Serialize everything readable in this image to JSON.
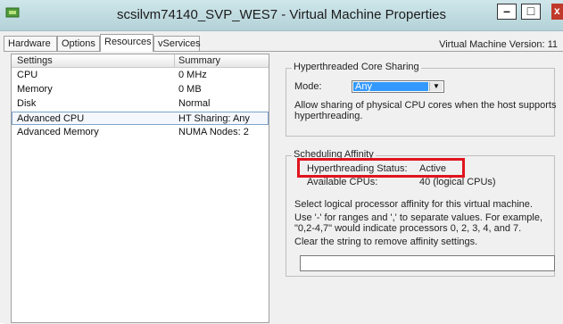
{
  "window": {
    "title": "scsilvm74140_SVP_WES7 - Virtual Machine Properties",
    "minimize_label": "–",
    "maximize_label": "□",
    "close_label": "x",
    "vm_version": "Virtual Machine Version: 11"
  },
  "tabs": [
    {
      "label": "Hardware"
    },
    {
      "label": "Options"
    },
    {
      "label": "Resources"
    },
    {
      "label": "vServices"
    }
  ],
  "table": {
    "headers": [
      "Settings",
      "Summary"
    ],
    "rows": [
      {
        "setting": "CPU",
        "summary": "0 MHz"
      },
      {
        "setting": "Memory",
        "summary": "0 MB"
      },
      {
        "setting": "Disk",
        "summary": "Normal"
      },
      {
        "setting": "Advanced CPU",
        "summary": "HT Sharing: Any"
      },
      {
        "setting": "Advanced Memory",
        "summary": "NUMA Nodes: 2"
      }
    ]
  },
  "ht_sharing": {
    "group_title": "Hyperthreaded Core Sharing",
    "mode_label": "Mode:",
    "mode_value": "Any",
    "description_line1": "Allow sharing of physical CPU cores when the host supports",
    "description_line2": "hyperthreading."
  },
  "affinity": {
    "group_title": "Scheduling Affinity",
    "ht_status_label": "Hyperthreading Status:",
    "ht_status_value": "Active",
    "cpus_label": "Available CPUs:",
    "cpus_value": "40 (logical CPUs)",
    "select_text": "Select logical processor affinity for this virtual machine.",
    "use_text_line1": "Use '-' for ranges and ',' to separate values. For example,",
    "use_text_line2": "\"0,2-4,7\" would indicate processors 0, 2, 3, 4, and 7.",
    "clear_text": "Clear the string to remove affinity settings.",
    "input_value": ""
  },
  "colors": {
    "titlebar": "#b3d2d8",
    "highlight": "#e0141e",
    "selection": "#3399ff"
  }
}
